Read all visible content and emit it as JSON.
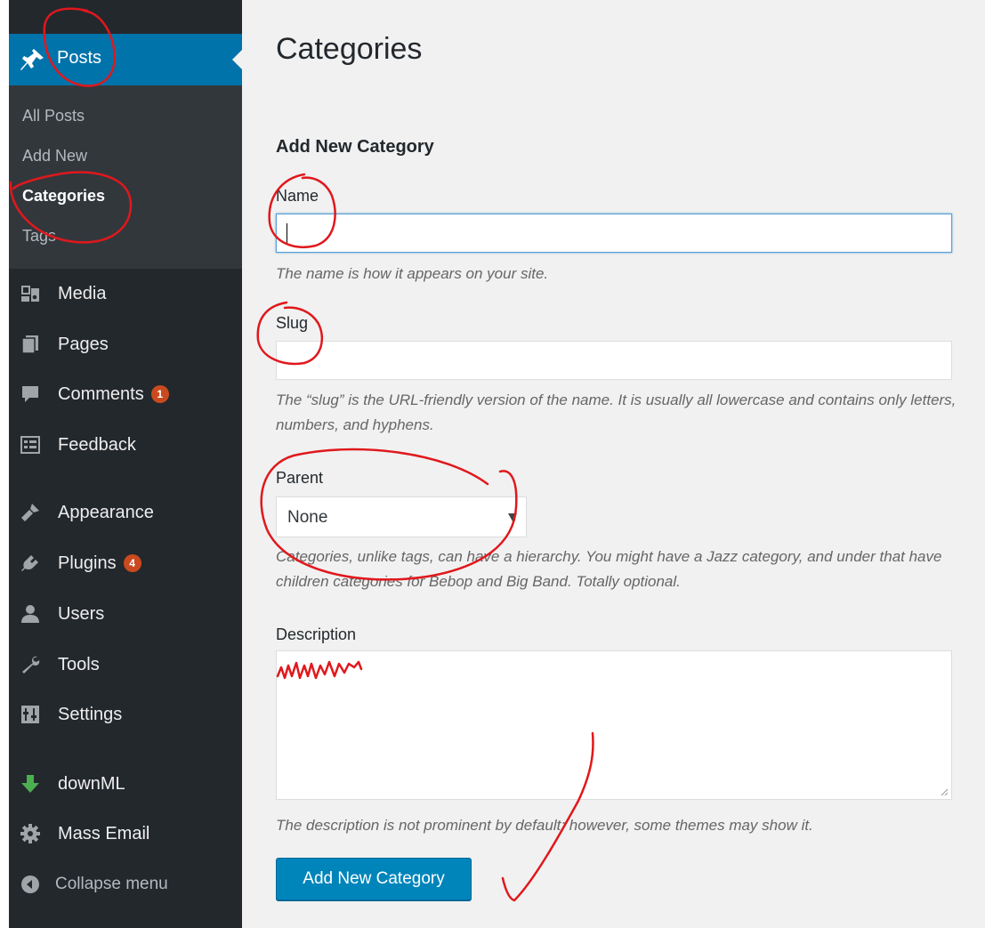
{
  "sidebar": {
    "posts_label": "Posts",
    "submenu": [
      {
        "label": "All Posts"
      },
      {
        "label": "Add New"
      },
      {
        "label": "Categories"
      },
      {
        "label": "Tags"
      }
    ],
    "items": [
      {
        "label": "Media",
        "icon": "media-icon"
      },
      {
        "label": "Pages",
        "icon": "pages-icon"
      },
      {
        "label": "Comments",
        "icon": "comments-icon",
        "badge": "1"
      },
      {
        "label": "Feedback",
        "icon": "feedback-icon"
      },
      {
        "label": "Appearance",
        "icon": "appearance-icon"
      },
      {
        "label": "Plugins",
        "icon": "plugins-icon",
        "badge": "4"
      },
      {
        "label": "Users",
        "icon": "users-icon"
      },
      {
        "label": "Tools",
        "icon": "tools-icon"
      },
      {
        "label": "Settings",
        "icon": "settings-icon"
      },
      {
        "label": "downML",
        "icon": "download-arrow-icon"
      },
      {
        "label": "Mass Email",
        "icon": "gear-icon"
      }
    ],
    "collapse_label": "Collapse menu"
  },
  "main": {
    "title": "Categories",
    "form_title": "Add New Category",
    "name": {
      "label": "Name",
      "value": "",
      "help": "The name is how it appears on your site."
    },
    "slug": {
      "label": "Slug",
      "value": "",
      "help": "The “slug” is the URL-friendly version of the name. It is usually all lowercase and contains only letters, numbers, and hyphens."
    },
    "parent": {
      "label": "Parent",
      "selected": "None",
      "help": "Categories, unlike tags, can have a hierarchy. You might have a Jazz category, and under that have children categories for Bebop and Big Band. Totally optional."
    },
    "description": {
      "label": "Description",
      "value": "",
      "help": "The description is not prominent by default; however, some themes may show it."
    },
    "submit_label": "Add New Category"
  },
  "colors": {
    "sidebar_bg": "#23282d",
    "submenu_bg": "#32373c",
    "accent": "#0073aa",
    "button": "#0085ba",
    "badge": "#ca4a1f",
    "annotation": "#e0181c"
  }
}
